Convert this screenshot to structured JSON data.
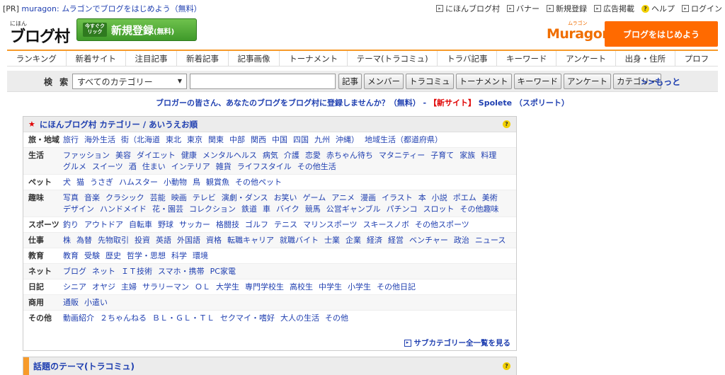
{
  "pr": {
    "tag": "[PR]",
    "text": "muragon: ムラゴンでブログをはじめよう（無料）"
  },
  "top_links": [
    {
      "label": "にほんブログ村"
    },
    {
      "label": "バナー"
    },
    {
      "label": "新規登録"
    },
    {
      "label": "広告掲載"
    },
    {
      "label": "ヘルプ"
    },
    {
      "label": "ログイン"
    }
  ],
  "header": {
    "logo_small": "にほん",
    "logo_main": "ブログ村",
    "reg_small": "今すぐクリック",
    "reg_text": "新規登録",
    "reg_suffix": "(無料)",
    "muragon_kana": "ムラゴン",
    "muragon_name": "Muragon",
    "start_button": "ブログをはじめよう"
  },
  "nav_tabs": [
    "ランキング",
    "新着サイト",
    "注目記事",
    "新着記事",
    "記事画像",
    "トーナメント",
    "テーマ(トラコミュ)",
    "トラバ記事",
    "キーワード",
    "アンケート",
    "出身・住所",
    "プロフ"
  ],
  "search": {
    "label": "検 索",
    "category_selected": "すべてのカテゴリー",
    "input_value": "",
    "buttons": [
      "記事",
      "メンバー",
      "トラコミュ",
      "トーナメント",
      "キーワード",
      "アンケート",
      "カテゴリー"
    ],
    "more": ">>もっと"
  },
  "promo": {
    "text": "ブロガーの皆さん、あなたのブログをブログ村に登録しませんか？（無料） - ",
    "new_site": "【新サイト】",
    "site_name": " Spolete （スポリート）"
  },
  "categories": {
    "title": "にほんブログ村 カテゴリー / あいうえお順",
    "rows": [
      {
        "label": "旅・地域",
        "items": [
          "旅行",
          "海外生活",
          "街（北海道",
          "東北",
          "東京",
          "関東",
          "中部",
          "関西",
          "中国",
          "四国",
          "九州",
          "沖縄）",
          "地域生活（都道府県）"
        ]
      },
      {
        "label": "生活",
        "items": [
          "ファッション",
          "美容",
          "ダイエット",
          "健康",
          "メンタルヘルス",
          "病気",
          "介護",
          "恋愛",
          "赤ちゃん待ち",
          "マタニティー",
          "子育て",
          "家族",
          "料理",
          "グルメ",
          "スイーツ",
          "酒",
          "住まい",
          "インテリア",
          "雑貨",
          "ライフスタイル",
          "その他生活"
        ]
      },
      {
        "label": "ペット",
        "items": [
          "犬",
          "猫",
          "うさぎ",
          "ハムスター",
          "小動物",
          "鳥",
          "観賞魚",
          "その他ペット"
        ]
      },
      {
        "label": "趣味",
        "items": [
          "写真",
          "音楽",
          "クラシック",
          "芸能",
          "映画",
          "テレビ",
          "演劇・ダンス",
          "お笑い",
          "ゲーム",
          "アニメ",
          "漫画",
          "イラスト",
          "本",
          "小説",
          "ポエム",
          "美術",
          "デザイン",
          "ハンドメイド",
          "花・園芸",
          "コレクション",
          "鉄道",
          "車",
          "バイク",
          "競馬",
          "公営ギャンブル",
          "パチンコ",
          "スロット",
          "その他趣味"
        ]
      },
      {
        "label": "スポーツ",
        "items": [
          "釣り",
          "アウトドア",
          "自転車",
          "野球",
          "サッカー",
          "格闘技",
          "ゴルフ",
          "テニス",
          "マリンスポーツ",
          "スキースノボ",
          "その他スポーツ"
        ]
      },
      {
        "label": "仕事",
        "items": [
          "株",
          "為替",
          "先物取引",
          "投資",
          "英語",
          "外国語",
          "資格",
          "転職キャリア",
          "就職バイト",
          "士業",
          "企業",
          "経済",
          "経営",
          "ベンチャー",
          "政治",
          "ニュース"
        ]
      },
      {
        "label": "教育",
        "items": [
          "教育",
          "受験",
          "歴史",
          "哲学・思想",
          "科学",
          "環境"
        ]
      },
      {
        "label": "ネット",
        "items": [
          "ブログ",
          "ネット",
          "ＩＴ技術",
          "スマホ・携帯",
          "PC家電"
        ]
      },
      {
        "label": "日記",
        "items": [
          "シニア",
          "オヤジ",
          "主婦",
          "サラリーマン",
          "ＯＬ",
          "大学生",
          "専門学校生",
          "高校生",
          "中学生",
          "小学生",
          "その他日記"
        ]
      },
      {
        "label": "商用",
        "items": [
          "通販",
          "小遣い"
        ]
      },
      {
        "label": "その他",
        "items": [
          "動画紹介",
          "２ちゃんねる",
          "ＢＬ・ＧＬ・ＴＬ",
          "セクマイ・嗜好",
          "大人の生活",
          "その他"
        ]
      }
    ],
    "footer_link": "サブカテゴリー全一覧を見る"
  },
  "theme": {
    "title": "話題のテーマ(トラコミュ)"
  },
  "icons": {
    "help": "help-icon",
    "arrow": "square-arrow-icon"
  },
  "colors": {
    "accent": "#f79a2a",
    "link": "#1f3fb0",
    "cta": "#ff6a00",
    "register_green": "#4fab35"
  }
}
